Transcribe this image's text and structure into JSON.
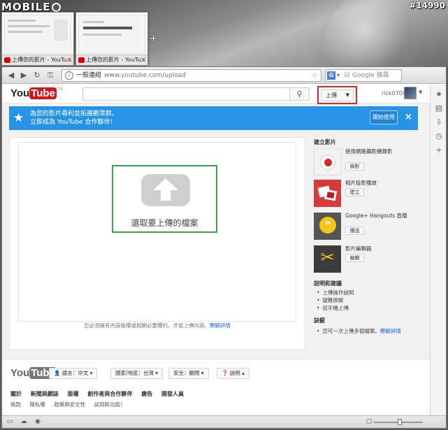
{
  "watermark": {
    "brand": "MOBILE",
    "post_id": "#14990"
  },
  "tab_thumbnails": [
    {
      "title": "上傳您的影片 - YouTu..."
    },
    {
      "title": "上傳您的影片 - YouTu..."
    }
  ],
  "browser": {
    "security_label": "一般連線",
    "url": "www.youtube.com/upload",
    "search_placeholder": "以 Google 搜尋",
    "search_engine": "G"
  },
  "youtube": {
    "logo_you": "You",
    "logo_tube": "Tube",
    "logo_region": "TW",
    "upload_label": "上傳",
    "username": "rick0708",
    "banner": {
      "line1": "為您的影片尋利並拓展觀眾群。",
      "line2": "立即成為 YouTube 合作夥伴！",
      "start_label": "開始使用",
      "close": "×"
    },
    "select_files": "選取要上傳的檔案",
    "rights_note": "您必須擁有內容版權或相關必要權利，才能上傳內容。",
    "rights_link": "瞭解詳情",
    "create_heading": "建立影片",
    "create_items": [
      {
        "title": "使用網路攝影機錄影",
        "button": "錄影",
        "icon": "webcam-record-icon"
      },
      {
        "title": "相片投影播放",
        "button": "建立",
        "icon": "photo-slideshow-icon"
      },
      {
        "title": "Google+ Hangouts 直播",
        "button": "播送",
        "icon": "hangouts-icon"
      },
      {
        "title": "影片編輯器",
        "button": "編輯",
        "icon": "video-editor-icon"
      }
    ],
    "help_heading": "說明和建議",
    "help_items": [
      "上傳操作說明",
      "疑難排解",
      "從手機上傳"
    ],
    "tips_heading": "訣竅",
    "tip_text": "您可一次上傳多個檔案。",
    "tip_link": "瞭解詳情",
    "footer": {
      "language": "語言：中文",
      "country": "國家/地區：台灣",
      "safety": "安全：關閉",
      "help": "說明",
      "links_primary": [
        "關於",
        "新聞與網誌",
        "版權",
        "創作者與合作夥伴",
        "廣告",
        "開發人員"
      ],
      "links_secondary": [
        "條款",
        "隱私權",
        "政策與安全性",
        "試用新功能！"
      ]
    }
  },
  "colors": {
    "banner_blue": "#2793e6",
    "highlight_red": "#d42a2a",
    "select_green": "#3aa24a"
  }
}
